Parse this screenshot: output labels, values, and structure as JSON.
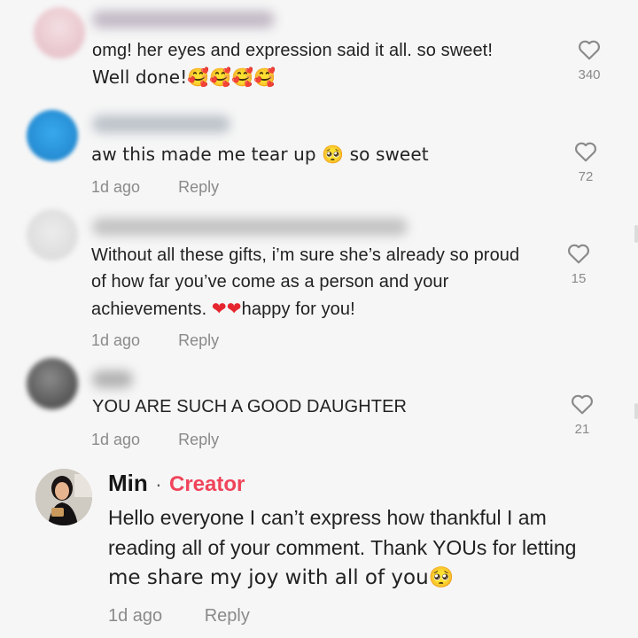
{
  "comments": [
    {
      "text_line1": "omg! her eyes and expression said it all. so sweet!",
      "text_line2": "Well done!🥰🥰🥰🥰",
      "likes": "340",
      "avatar_color": "#e8c9cf"
    },
    {
      "text": "aw this made me tear up 🥺 so sweet",
      "time": "1d ago",
      "reply": "Reply",
      "likes": "72",
      "avatar_color": "#2f9be0"
    },
    {
      "text_line1": "Without all these gifts, i’m sure she’s already so proud",
      "text_line2": "of how far you’ve come as a person and your",
      "text_line3_pre": "achievements. ",
      "text_line3_hearts": "❤❤",
      "text_line3_post": "happy for you!",
      "time": "1d ago",
      "reply": "Reply",
      "likes": "15",
      "avatar_color": "#d9d9d9"
    },
    {
      "text": "YOU ARE SUCH A GOOD DAUGHTER",
      "time": "1d ago",
      "reply": "Reply",
      "likes": "21",
      "avatar_color": "#6b6b6b"
    }
  ],
  "creator_comment": {
    "name": "Min",
    "separator": "·",
    "badge": "Creator",
    "line1": "Hello everyone I can’t express how thankful I am",
    "line2": "reading all of your comment. Thank YOUs for letting",
    "line3": "me share my joy with all of you🥺",
    "time": "1d ago",
    "reply": "Reply",
    "accent_color": "#f0445a"
  }
}
